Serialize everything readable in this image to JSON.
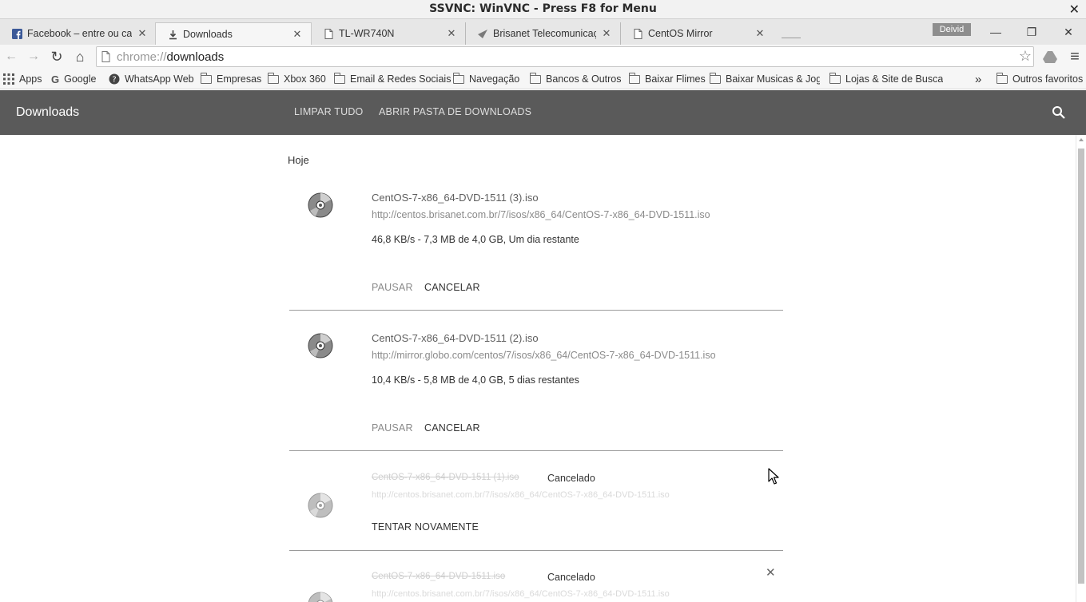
{
  "vnc": {
    "title": "SSVNC: WinVNC - Press F8 for Menu",
    "close_glyph": "✕"
  },
  "tabs": [
    {
      "label": "Facebook – entre ou cada",
      "icon": "facebook-icon",
      "close": "✕"
    },
    {
      "label": "Downloads",
      "icon": "download-icon",
      "close": "✕",
      "active": true
    },
    {
      "label": "TL-WR740N",
      "icon": "page-icon",
      "close": "✕"
    },
    {
      "label": "Brisanet Telecomunicaçõe",
      "icon": "brisanet-icon",
      "close": "✕"
    },
    {
      "label": "CentOS Mirror",
      "icon": "page-icon",
      "close": "✕"
    }
  ],
  "profile": {
    "name": "Deivid"
  },
  "window_controls": {
    "minimize": "—",
    "restore": "❐",
    "close": "✕"
  },
  "toolbar": {
    "back": "←",
    "forward": "→",
    "reload": "↻",
    "home": "⌂",
    "url_scheme": "chrome://",
    "url_path": "downloads",
    "star": "☆",
    "menu": "≡"
  },
  "bookmarks": {
    "items": [
      {
        "label": "Apps",
        "icon": "apps-grid-icon"
      },
      {
        "label": "Google",
        "icon": "google-icon"
      },
      {
        "label": "WhatsApp Web",
        "icon": "whatsapp-icon"
      },
      {
        "label": "Empresas",
        "icon": "folder-icon"
      },
      {
        "label": "Xbox 360",
        "icon": "folder-icon"
      },
      {
        "label": "Email & Redes Sociais",
        "icon": "folder-icon"
      },
      {
        "label": "Navegação",
        "icon": "folder-icon"
      },
      {
        "label": "Bancos & Outros",
        "icon": "folder-icon"
      },
      {
        "label": "Baixar Flimes",
        "icon": "folder-icon"
      },
      {
        "label": "Baixar Musicas & Jogos",
        "icon": "folder-icon"
      },
      {
        "label": "Lojas & Site de Busca",
        "icon": "folder-icon"
      }
    ],
    "overflow": "»",
    "other": "Outros favoritos"
  },
  "downloads_page": {
    "title": "Downloads",
    "clear_all": "LIMPAR TUDO",
    "open_folder": "ABRIR PASTA DE DOWNLOADS",
    "day_label": "Hoje",
    "items": [
      {
        "file": "CentOS-7-x86_64-DVD-1511 (3).iso",
        "url": "http://centos.brisanet.com.br/7/isos/x86_64/CentOS-7-x86_64-DVD-1511.iso",
        "status": "46,8 KB/s - 7,3 MB de 4,0 GB, Um dia restante",
        "pause": "PAUSAR",
        "cancel": "CANCELAR"
      },
      {
        "file": "CentOS-7-x86_64-DVD-1511 (2).iso",
        "url": "http://mirror.globo.com/centos/7/isos/x86_64/CentOS-7-x86_64-DVD-1511.iso",
        "status": "10,4 KB/s - 5,8 MB de 4,0 GB, 5 dias restantes",
        "pause": "PAUSAR",
        "cancel": "CANCELAR"
      },
      {
        "file": "CentOS-7-x86_64-DVD-1511 (1).iso",
        "url": "http://centos.brisanet.com.br/7/isos/x86_64/CentOS-7-x86_64-DVD-1511.iso",
        "state": "Cancelado",
        "retry": "TENTAR NOVAMENTE"
      },
      {
        "file": "CentOS-7-x86_64-DVD-1511.iso",
        "url": "http://centos.brisanet.com.br/7/isos/x86_64/CentOS-7-x86_64-DVD-1511.iso",
        "state": "Cancelado",
        "remove": "✕"
      }
    ]
  }
}
